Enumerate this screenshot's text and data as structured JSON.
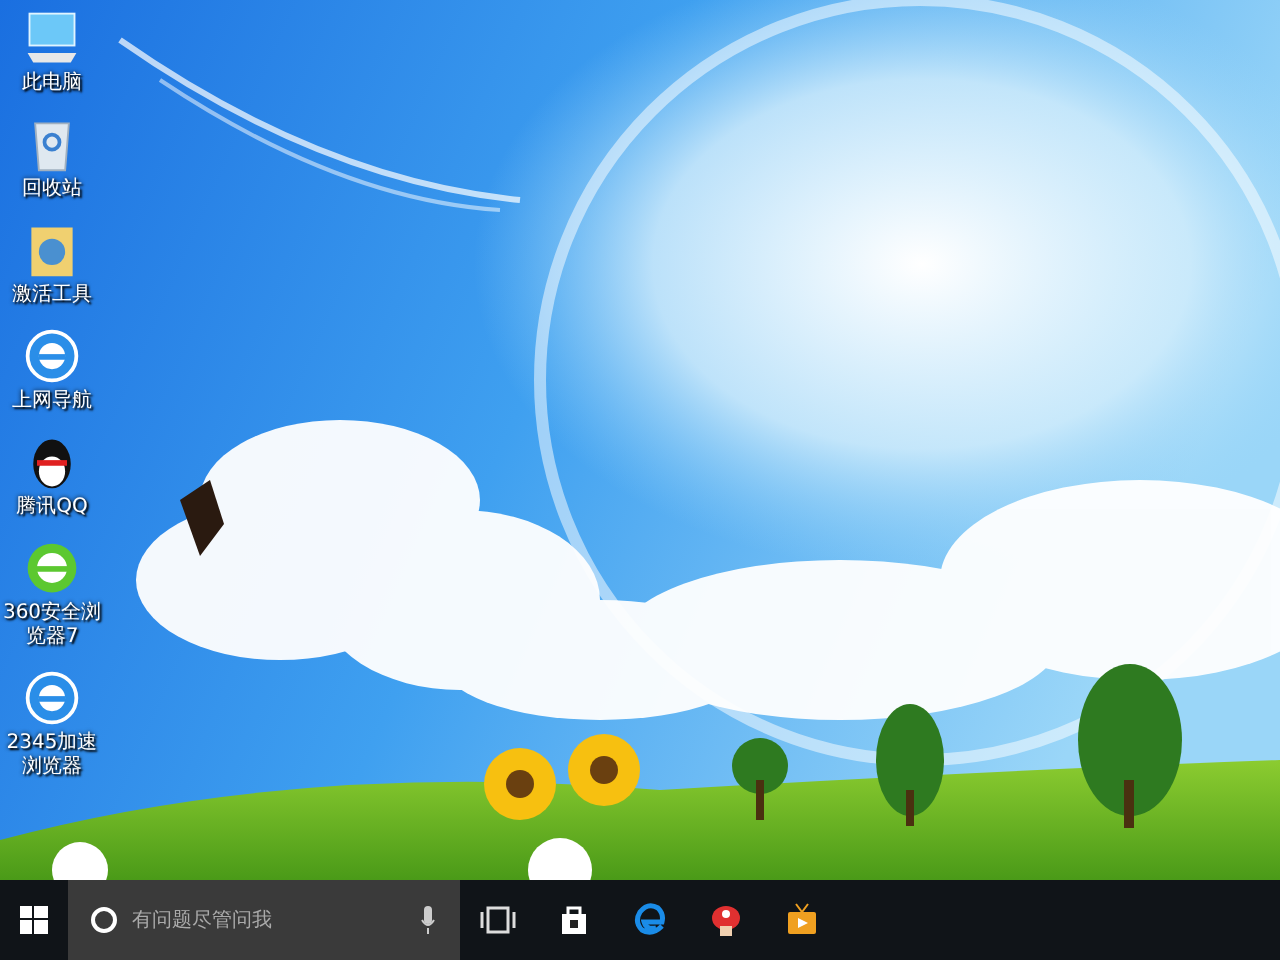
{
  "desktop_icons": [
    {
      "label": "此电脑",
      "kind": "computer"
    },
    {
      "label": "回收站",
      "kind": "recycle"
    },
    {
      "label": "激活工具",
      "kind": "tool"
    },
    {
      "label": "上网导航",
      "kind": "ie"
    },
    {
      "label": "腾讯QQ",
      "kind": "penguin"
    },
    {
      "label": "360安全浏览器7",
      "kind": "ie-green"
    },
    {
      "label": "2345加速浏览器",
      "kind": "ie"
    }
  ],
  "taskbar": {
    "search": {
      "placeholder": "有问题尽管问我"
    },
    "pinned": [
      {
        "kind": "task-view"
      },
      {
        "kind": "store"
      },
      {
        "kind": "edge"
      },
      {
        "kind": "mushroom"
      },
      {
        "kind": "tv"
      }
    ]
  }
}
